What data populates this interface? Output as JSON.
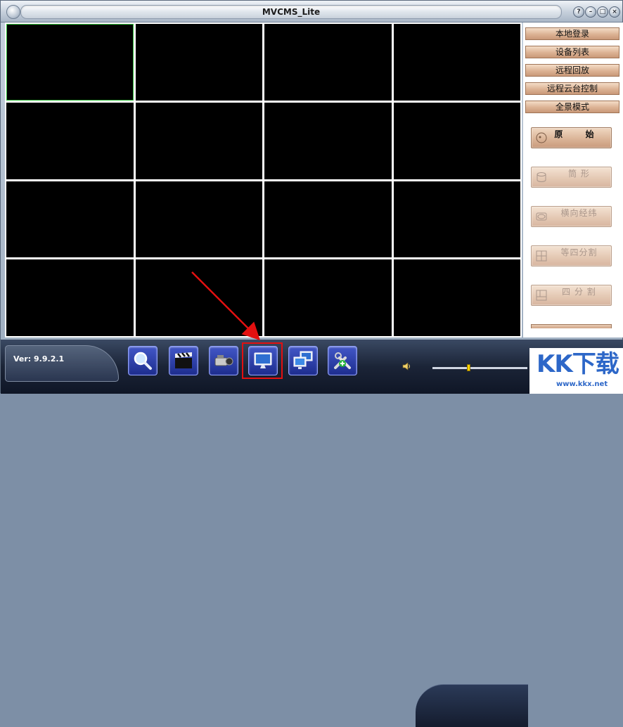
{
  "window": {
    "title": "MVCMS_Lite"
  },
  "titlebar_buttons": [
    {
      "icon": "help-icon",
      "glyph": "?"
    },
    {
      "icon": "minimize-icon",
      "glyph": "–"
    },
    {
      "icon": "maximize-icon",
      "glyph": "□"
    },
    {
      "icon": "close-icon",
      "glyph": "×"
    }
  ],
  "video_grid": {
    "rows": 4,
    "columns": 4,
    "selected_cell": 0
  },
  "menu": {
    "local_login": "本地登录",
    "device_list": "设备列表",
    "remote_playback": "远程回放",
    "remote_ptz": "远程云台控制",
    "panorama_mode": "全景模式"
  },
  "modes": [
    {
      "label": "原 始",
      "icon": "circle-lens-icon",
      "enabled": true
    },
    {
      "label": "筒 形",
      "icon": "cylinder-icon",
      "enabled": false
    },
    {
      "label": "横向经纬",
      "icon": "ellipse-icon",
      "enabled": false
    },
    {
      "label": "等四分割",
      "icon": "quad-split-icon",
      "enabled": false
    },
    {
      "label": "四 分 割",
      "icon": "split-icon",
      "enabled": false
    }
  ],
  "footer": {
    "version": "Ver: 9.9.2.1"
  },
  "toolbar": [
    {
      "icon": "search-icon"
    },
    {
      "icon": "clapperboard-icon"
    },
    {
      "icon": "video-camera-icon"
    },
    {
      "icon": "monitor-icon"
    },
    {
      "icon": "multi-monitor-icon"
    },
    {
      "icon": "tools-settings-icon"
    }
  ],
  "volume": {
    "level": 0.38
  },
  "watermark": {
    "logo": "KK下载",
    "url": "www.kkx.net"
  },
  "colors": {
    "selected_cell_border": "#2fbf3a",
    "annotation_red": "#e31010",
    "button_blue": "#2b3fb0"
  }
}
